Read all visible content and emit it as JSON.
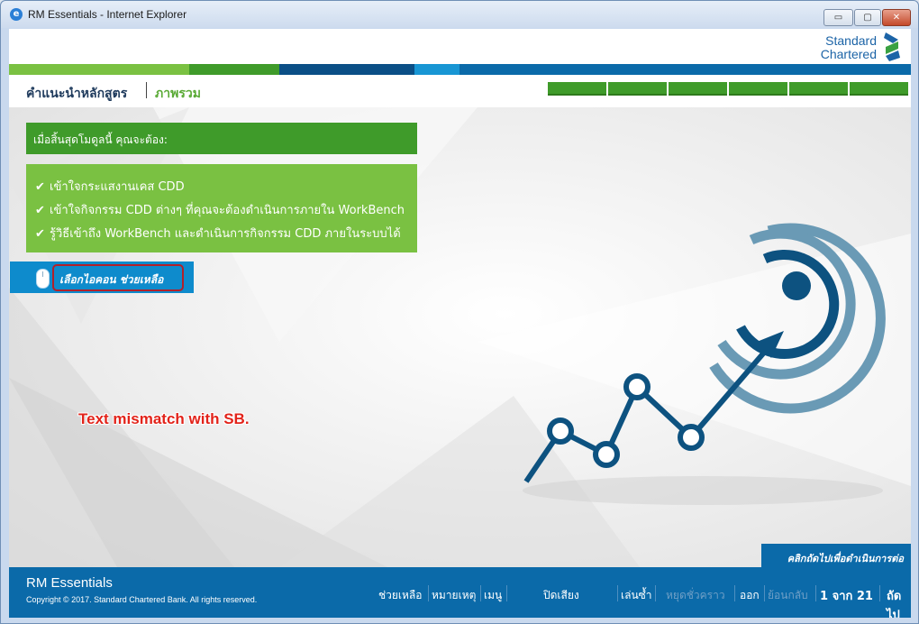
{
  "window": {
    "title": "RM Essentials - Internet Explorer",
    "buttons": {
      "minimize": "▭",
      "maximize": "▢",
      "close": "✕"
    }
  },
  "brand": {
    "line1": "Standard",
    "line2": "Chartered"
  },
  "header": {
    "breadcrumb_course": "คำแนะนำหลักสูตร",
    "breadcrumb_section": "ภาพรวม"
  },
  "objectives": {
    "heading": "เมื่อสิ้นสุดโมดูลนี้ คุณจะต้อง:",
    "items": [
      "เข้าใจกระแสงานเคส CDD",
      "เข้าใจกิจกรรม CDD ต่างๆ ที่คุณจะต้องดำเนินการภายใน WorkBench",
      "รู้วิธีเข้าถึง WorkBench และดำเนินการกิจกรรม CDD ภายในระบบได้"
    ],
    "check_glyph": "✔"
  },
  "help_prompt": {
    "label": "เลือกไอคอน ช่วยเหลือ"
  },
  "annotation": {
    "text": "Text mismatch with SB."
  },
  "next_hint": {
    "text": "คลิกถัดไปเพื่อดำเนินการต่อ"
  },
  "footer": {
    "title": "RM Essentials",
    "copyright": "Copyright © 2017. Standard Chartered Bank. All rights reserved.",
    "nav": {
      "help": "ช่วยเหลือ",
      "notes": "หมายเหตุ",
      "menu": "เมนู",
      "mute": "ปิดเสียง",
      "replay": "เล่นซ้ำ",
      "pause": "หยุดชั่วคราว",
      "exit": "ออก",
      "back": "ย้อนกลับ",
      "page_indicator": "1 จาก 21",
      "next": "ถัดไป"
    }
  },
  "colors": {
    "brand_blue": "#0b6aa9",
    "brand_green": "#3f9b2a",
    "light_green": "#7ac142",
    "help_blue": "#0e8bcc",
    "annotation_red": "#e2231a"
  },
  "icons": [
    "ie-icon",
    "check-icon",
    "mouse-icon",
    "target-icon",
    "chart-line-icon",
    "standard-chartered-logo"
  ]
}
